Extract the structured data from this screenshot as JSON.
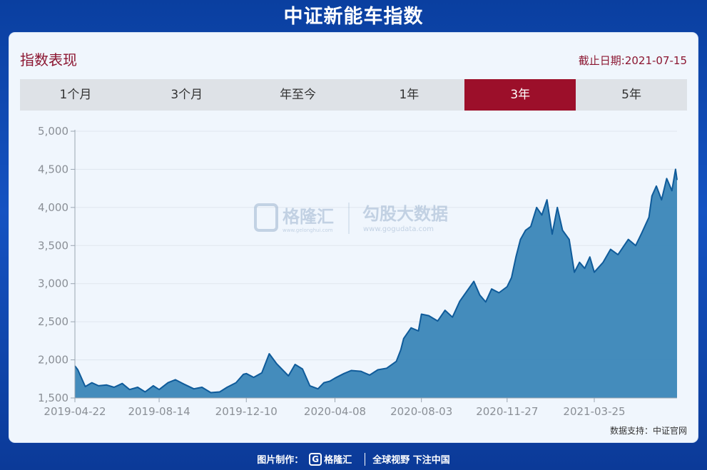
{
  "page": {
    "title": "中证新能车指数"
  },
  "panel": {
    "title": "指数表现",
    "as_of": "截止日期:2021-07-15",
    "source": "数据支持：中证官网"
  },
  "tabs": [
    {
      "label": "1个月",
      "active": false
    },
    {
      "label": "3个月",
      "active": false
    },
    {
      "label": "年至今",
      "active": false
    },
    {
      "label": "1年",
      "active": false
    },
    {
      "label": "3年",
      "active": true
    },
    {
      "label": "5年",
      "active": false
    }
  ],
  "watermark": {
    "brand1": "格隆汇",
    "brand1_url": "www.gelonghui.com",
    "brand2": "勾股大数据",
    "brand2_url": "www.gogudata.com"
  },
  "footer": {
    "made_by": "图片制作：",
    "brand": "格隆汇",
    "slogan": "全球视野 下注中国"
  },
  "colors": {
    "accent": "#9c0f2a",
    "line": "#0f5b9a",
    "area": "#3a86b8"
  },
  "chart_data": {
    "type": "area",
    "x_ticks": [
      "2019-04-22",
      "2019-08-14",
      "2019-12-10",
      "2020-04-08",
      "2020-08-03",
      "2020-11-27",
      "2021-03-25"
    ],
    "ylim": [
      1500,
      5000
    ],
    "y_ticks": [
      1500,
      2000,
      2500,
      3000,
      3500,
      4000,
      4500,
      5000
    ],
    "y_tick_labels": [
      "1,500",
      "2,000",
      "2,500",
      "3,000",
      "3,500",
      "4,000",
      "4,500",
      "5,000"
    ],
    "grid": true,
    "series": [
      {
        "x": [
          "2019-04-22",
          "2019-04-26",
          "2019-05-06",
          "2019-05-15",
          "2019-05-24",
          "2019-06-04",
          "2019-06-14",
          "2019-06-25",
          "2019-07-05",
          "2019-07-16",
          "2019-07-26",
          "2019-08-06",
          "2019-08-14",
          "2019-08-26",
          "2019-09-05",
          "2019-09-17",
          "2019-09-30",
          "2019-10-11",
          "2019-10-23",
          "2019-11-04",
          "2019-11-14",
          "2019-11-26",
          "2019-12-06",
          "2019-12-10",
          "2019-12-20",
          "2019-12-31",
          "2020-01-10",
          "2020-01-20",
          "2020-02-05",
          "2020-02-14",
          "2020-02-24",
          "2020-03-05",
          "2020-03-16",
          "2020-03-24",
          "2020-04-01",
          "2020-04-08",
          "2020-04-20",
          "2020-04-30",
          "2020-05-13",
          "2020-05-25",
          "2020-06-05",
          "2020-06-17",
          "2020-06-30",
          "2020-07-06",
          "2020-07-10",
          "2020-07-20",
          "2020-07-30",
          "2020-08-03",
          "2020-08-13",
          "2020-08-25",
          "2020-09-04",
          "2020-09-14",
          "2020-09-24",
          "2020-10-13",
          "2020-10-21",
          "2020-10-29",
          "2020-11-06",
          "2020-11-16",
          "2020-11-27",
          "2020-12-03",
          "2020-12-09",
          "2020-12-15",
          "2020-12-22",
          "2020-12-29",
          "2021-01-06",
          "2021-01-13",
          "2021-01-20",
          "2021-01-27",
          "2021-02-03",
          "2021-02-10",
          "2021-02-19",
          "2021-02-26",
          "2021-03-05",
          "2021-03-12",
          "2021-03-19",
          "2021-03-25",
          "2021-04-06",
          "2021-04-16",
          "2021-04-26",
          "2021-05-10",
          "2021-05-20",
          "2021-05-28",
          "2021-06-07",
          "2021-06-11",
          "2021-06-17",
          "2021-06-24",
          "2021-07-01",
          "2021-07-08",
          "2021-07-13",
          "2021-07-15"
        ],
        "values": [
          1920,
          1870,
          1650,
          1700,
          1660,
          1670,
          1640,
          1690,
          1610,
          1640,
          1580,
          1660,
          1610,
          1700,
          1740,
          1680,
          1620,
          1640,
          1570,
          1580,
          1640,
          1700,
          1810,
          1820,
          1770,
          1830,
          2080,
          1950,
          1790,
          1940,
          1880,
          1660,
          1620,
          1700,
          1720,
          1760,
          1820,
          1860,
          1850,
          1800,
          1870,
          1890,
          1980,
          2130,
          2280,
          2420,
          2380,
          2600,
          2580,
          2510,
          2650,
          2560,
          2770,
          3030,
          2850,
          2760,
          2930,
          2880,
          2960,
          3080,
          3350,
          3580,
          3700,
          3750,
          4000,
          3900,
          4100,
          3650,
          4000,
          3700,
          3580,
          3150,
          3280,
          3200,
          3350,
          3150,
          3280,
          3450,
          3380,
          3580,
          3500,
          3660,
          3870,
          4150,
          4280,
          4100,
          4380,
          4220,
          4500,
          4360
        ]
      }
    ]
  }
}
